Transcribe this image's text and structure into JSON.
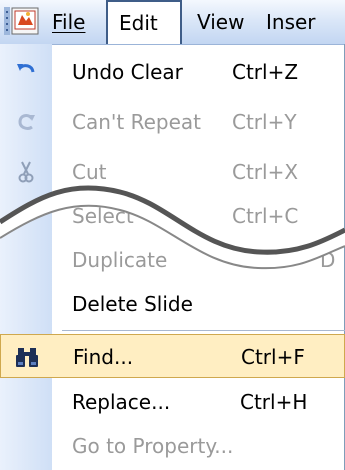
{
  "menubar": {
    "items": [
      {
        "label": "File"
      },
      {
        "label": "Edit"
      },
      {
        "label": "View"
      },
      {
        "label": "Inser"
      }
    ]
  },
  "menu": {
    "items": [
      {
        "label": "Undo Clear",
        "shortcut": "Ctrl+Z",
        "icon": "undo-icon",
        "enabled": true
      },
      {
        "label": "Can't Repeat",
        "shortcut": "Ctrl+Y",
        "icon": "redo-icon",
        "enabled": false
      },
      {
        "label": "Cut",
        "shortcut": "Ctrl+X",
        "icon": "scissors-icon",
        "enabled": false
      },
      {
        "label": "Select",
        "shortcut": "Ctrl+C",
        "enabled": false
      },
      {
        "label": "Duplicate",
        "shortcut": "D",
        "enabled": false
      },
      {
        "label": "Delete Slide",
        "shortcut": "",
        "enabled": true
      },
      {
        "label": "Find...",
        "shortcut": "Ctrl+F",
        "icon": "binoculars-icon",
        "enabled": true,
        "highlighted": true
      },
      {
        "label": "Replace...",
        "shortcut": "Ctrl+H",
        "enabled": true
      },
      {
        "label": "Go to Property...",
        "shortcut": "",
        "enabled": false
      }
    ]
  },
  "colors": {
    "highlight_bg": "#ffeec2",
    "highlight_border": "#cfa84e",
    "disabled_text": "#9a9a9a",
    "gutter": "#cfdff6"
  }
}
